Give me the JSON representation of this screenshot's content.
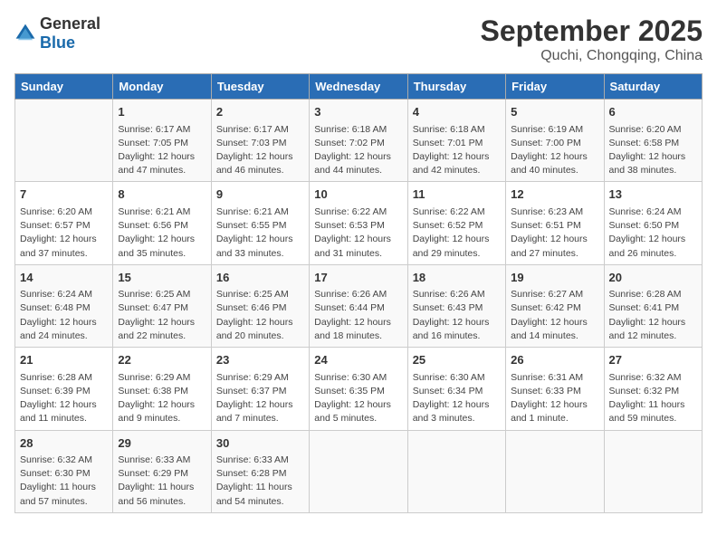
{
  "header": {
    "logo_general": "General",
    "logo_blue": "Blue",
    "month": "September 2025",
    "location": "Quchi, Chongqing, China"
  },
  "weekdays": [
    "Sunday",
    "Monday",
    "Tuesday",
    "Wednesday",
    "Thursday",
    "Friday",
    "Saturday"
  ],
  "weeks": [
    [
      {
        "day": "",
        "info": ""
      },
      {
        "day": "1",
        "info": "Sunrise: 6:17 AM\nSunset: 7:05 PM\nDaylight: 12 hours\nand 47 minutes."
      },
      {
        "day": "2",
        "info": "Sunrise: 6:17 AM\nSunset: 7:03 PM\nDaylight: 12 hours\nand 46 minutes."
      },
      {
        "day": "3",
        "info": "Sunrise: 6:18 AM\nSunset: 7:02 PM\nDaylight: 12 hours\nand 44 minutes."
      },
      {
        "day": "4",
        "info": "Sunrise: 6:18 AM\nSunset: 7:01 PM\nDaylight: 12 hours\nand 42 minutes."
      },
      {
        "day": "5",
        "info": "Sunrise: 6:19 AM\nSunset: 7:00 PM\nDaylight: 12 hours\nand 40 minutes."
      },
      {
        "day": "6",
        "info": "Sunrise: 6:20 AM\nSunset: 6:58 PM\nDaylight: 12 hours\nand 38 minutes."
      }
    ],
    [
      {
        "day": "7",
        "info": "Sunrise: 6:20 AM\nSunset: 6:57 PM\nDaylight: 12 hours\nand 37 minutes."
      },
      {
        "day": "8",
        "info": "Sunrise: 6:21 AM\nSunset: 6:56 PM\nDaylight: 12 hours\nand 35 minutes."
      },
      {
        "day": "9",
        "info": "Sunrise: 6:21 AM\nSunset: 6:55 PM\nDaylight: 12 hours\nand 33 minutes."
      },
      {
        "day": "10",
        "info": "Sunrise: 6:22 AM\nSunset: 6:53 PM\nDaylight: 12 hours\nand 31 minutes."
      },
      {
        "day": "11",
        "info": "Sunrise: 6:22 AM\nSunset: 6:52 PM\nDaylight: 12 hours\nand 29 minutes."
      },
      {
        "day": "12",
        "info": "Sunrise: 6:23 AM\nSunset: 6:51 PM\nDaylight: 12 hours\nand 27 minutes."
      },
      {
        "day": "13",
        "info": "Sunrise: 6:24 AM\nSunset: 6:50 PM\nDaylight: 12 hours\nand 26 minutes."
      }
    ],
    [
      {
        "day": "14",
        "info": "Sunrise: 6:24 AM\nSunset: 6:48 PM\nDaylight: 12 hours\nand 24 minutes."
      },
      {
        "day": "15",
        "info": "Sunrise: 6:25 AM\nSunset: 6:47 PM\nDaylight: 12 hours\nand 22 minutes."
      },
      {
        "day": "16",
        "info": "Sunrise: 6:25 AM\nSunset: 6:46 PM\nDaylight: 12 hours\nand 20 minutes."
      },
      {
        "day": "17",
        "info": "Sunrise: 6:26 AM\nSunset: 6:44 PM\nDaylight: 12 hours\nand 18 minutes."
      },
      {
        "day": "18",
        "info": "Sunrise: 6:26 AM\nSunset: 6:43 PM\nDaylight: 12 hours\nand 16 minutes."
      },
      {
        "day": "19",
        "info": "Sunrise: 6:27 AM\nSunset: 6:42 PM\nDaylight: 12 hours\nand 14 minutes."
      },
      {
        "day": "20",
        "info": "Sunrise: 6:28 AM\nSunset: 6:41 PM\nDaylight: 12 hours\nand 12 minutes."
      }
    ],
    [
      {
        "day": "21",
        "info": "Sunrise: 6:28 AM\nSunset: 6:39 PM\nDaylight: 12 hours\nand 11 minutes."
      },
      {
        "day": "22",
        "info": "Sunrise: 6:29 AM\nSunset: 6:38 PM\nDaylight: 12 hours\nand 9 minutes."
      },
      {
        "day": "23",
        "info": "Sunrise: 6:29 AM\nSunset: 6:37 PM\nDaylight: 12 hours\nand 7 minutes."
      },
      {
        "day": "24",
        "info": "Sunrise: 6:30 AM\nSunset: 6:35 PM\nDaylight: 12 hours\nand 5 minutes."
      },
      {
        "day": "25",
        "info": "Sunrise: 6:30 AM\nSunset: 6:34 PM\nDaylight: 12 hours\nand 3 minutes."
      },
      {
        "day": "26",
        "info": "Sunrise: 6:31 AM\nSunset: 6:33 PM\nDaylight: 12 hours\nand 1 minute."
      },
      {
        "day": "27",
        "info": "Sunrise: 6:32 AM\nSunset: 6:32 PM\nDaylight: 11 hours\nand 59 minutes."
      }
    ],
    [
      {
        "day": "28",
        "info": "Sunrise: 6:32 AM\nSunset: 6:30 PM\nDaylight: 11 hours\nand 57 minutes."
      },
      {
        "day": "29",
        "info": "Sunrise: 6:33 AM\nSunset: 6:29 PM\nDaylight: 11 hours\nand 56 minutes."
      },
      {
        "day": "30",
        "info": "Sunrise: 6:33 AM\nSunset: 6:28 PM\nDaylight: 11 hours\nand 54 minutes."
      },
      {
        "day": "",
        "info": ""
      },
      {
        "day": "",
        "info": ""
      },
      {
        "day": "",
        "info": ""
      },
      {
        "day": "",
        "info": ""
      }
    ]
  ]
}
